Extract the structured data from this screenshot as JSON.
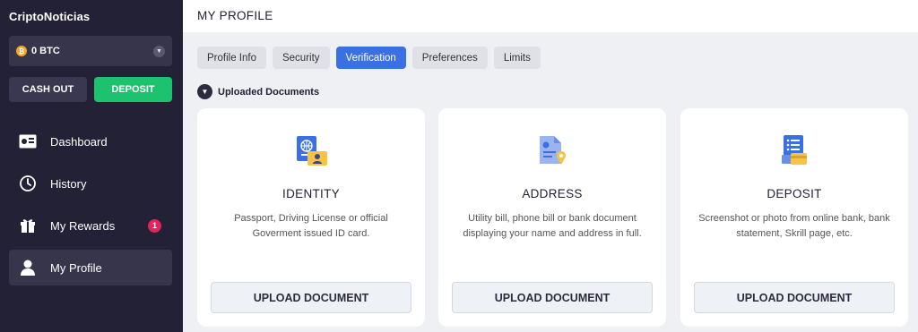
{
  "sidebar": {
    "brand": "CriptoNoticias",
    "wallet": {
      "label": "0 BTC",
      "coin_symbol": "₿"
    },
    "cashout_label": "CASH OUT",
    "deposit_label": "DEPOSIT",
    "items": [
      {
        "label": "Dashboard",
        "icon": "dashboard-icon"
      },
      {
        "label": "History",
        "icon": "history-icon"
      },
      {
        "label": "My Rewards",
        "icon": "gift-icon",
        "badge": "1"
      },
      {
        "label": "My Profile",
        "icon": "user-icon",
        "active": true
      }
    ]
  },
  "header": {
    "title": "MY PROFILE"
  },
  "tabs": [
    {
      "label": "Profile Info"
    },
    {
      "label": "Security"
    },
    {
      "label": "Verification",
      "active": true
    },
    {
      "label": "Preferences"
    },
    {
      "label": "Limits"
    }
  ],
  "section": {
    "title": "Uploaded Documents"
  },
  "cards": [
    {
      "title": "IDENTITY",
      "description": "Passport, Driving License or official Goverment issued ID card.",
      "button": "UPLOAD DOCUMENT",
      "icon": "passport-icon"
    },
    {
      "title": "ADDRESS",
      "description": "Utility bill, phone bill or bank document displaying your name and address in full.",
      "button": "UPLOAD DOCUMENT",
      "icon": "address-document-icon"
    },
    {
      "title": "DEPOSIT",
      "description": "Screenshot or photo from online bank, bank statement, Skrill page, etc.",
      "button": "UPLOAD DOCUMENT",
      "icon": "bank-statement-icon"
    }
  ],
  "colors": {
    "sidebar_bg": "#232135",
    "accent_blue": "#3b6fe4",
    "deposit_green": "#1dc26f",
    "badge_red": "#e0245e",
    "icon_yellow": "#f6c343"
  }
}
